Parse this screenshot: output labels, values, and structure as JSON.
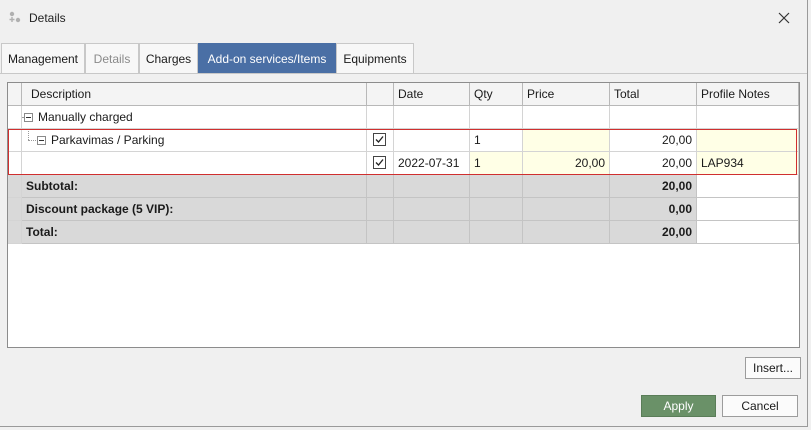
{
  "window": {
    "title": "Details",
    "app_icon": "app-icon",
    "close_icon": "close-icon"
  },
  "tabs": [
    {
      "label": "Management",
      "state": "normal"
    },
    {
      "label": "Details",
      "state": "disabled"
    },
    {
      "label": "Charges",
      "state": "normal"
    },
    {
      "label": "Add-on services/Items",
      "state": "active"
    },
    {
      "label": "Equipments",
      "state": "normal"
    }
  ],
  "grid": {
    "columns": [
      "Description",
      "",
      "Date",
      "Qty",
      "Price",
      "Total",
      "Profile Notes"
    ],
    "group": {
      "label": "Manually charged"
    },
    "item": {
      "description": "Parkavimas / Parking",
      "checked": true,
      "date": "",
      "qty": "1",
      "price": "",
      "total": "20,00",
      "notes": ""
    },
    "detail": {
      "description": "",
      "checked": true,
      "date": "2022-07-31",
      "qty": "1",
      "price": "20,00",
      "total": "20,00",
      "notes": "LAP934"
    },
    "summary": [
      {
        "label": "Subtotal:",
        "total": "20,00"
      },
      {
        "label": "Discount package (5 VIP):",
        "total": "0,00"
      },
      {
        "label": "Total:",
        "total": "20,00"
      }
    ]
  },
  "buttons": {
    "insert": "Insert...",
    "apply": "Apply",
    "cancel": "Cancel"
  },
  "colors": {
    "active_tab": "#4a6fa5",
    "apply_button": "#6a9168",
    "selection_outline": "#d02f2f",
    "editable_cell": "#ffffe6",
    "summary_row": "#d9d9d9"
  }
}
